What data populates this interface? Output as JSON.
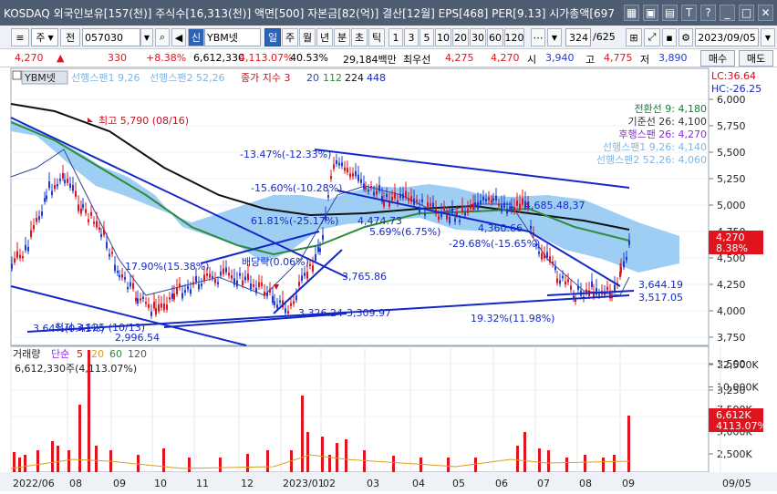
{
  "window": {
    "title": "KOSDAQ 외국인보유[157(천)] 주식수[16,313(천)] 액면[500] 자본금[82(억)] 결산[12월] EPS[468] PER[9.13] 시가총액[697"
  },
  "toolbar": {
    "type_select": "주",
    "prev_btn": "전",
    "code": "057030",
    "credit_badge": "신",
    "stock_name": "YBM넷",
    "period_buttons": [
      "일",
      "주",
      "월",
      "년",
      "분",
      "초",
      "틱"
    ],
    "active_period": "일",
    "interval_buttons": [
      "1",
      "3",
      "5",
      "10",
      "20",
      "30",
      "60",
      "120"
    ],
    "count": "324",
    "total": "/625",
    "date": "2023/09/05"
  },
  "price": {
    "current": "4,270",
    "arrow": "▲",
    "change": "330",
    "pct": "+8.38%",
    "volume": "6,612,330",
    "vol_pct": "4,113.07%",
    "turnover": "40.53%",
    "amount": "29,184백만",
    "pref_label": "최우선",
    "ask": "4,275",
    "bid": "4,270",
    "open_label": "시",
    "open": "3,940",
    "high_label": "고",
    "high": "4,775",
    "low_label": "저",
    "low": "3,890",
    "buy_btn": "매수",
    "sell_btn": "매도"
  },
  "chart_labels": {
    "stock_tag": "YBM넷",
    "span1_legend": "선행스팬1 9,26",
    "span2_legend": "선행스팬2 52,26",
    "ma_legend": "종가 지수 3",
    "ma_periods": [
      "20",
      "112",
      "224",
      "448"
    ],
    "lc": "LC:36.64",
    "hc": "HC:-26.25",
    "ichimoku": [
      {
        "text": "전환선 9: 4,180",
        "color": "#1a7a3a"
      },
      {
        "text": "기준선 26: 4,100",
        "color": "#333333"
      },
      {
        "text": "후행스팬 26: 4,270",
        "color": "#8a2be2"
      },
      {
        "text": "선행스팬1 9,26: 4,140",
        "color": "#7fb6e6"
      },
      {
        "text": "선행스팬2 52,26: 4,060",
        "color": "#7fb6e6"
      }
    ],
    "current_tag": "4,270",
    "current_pct_tag": "8.38%",
    "max_label": "최고 5,790 (08/16)",
    "min_label": "최저 3,125 (10/13)",
    "annotations": [
      "-13.47%(-12.33%)",
      "-15.60%(-10.28%)",
      "61.81%(-25.17%)",
      "4,474.73",
      "5.69%(6.75%)",
      "4,360.66",
      "4,685.48,37",
      "-29.68%(-15.65%)",
      "17.90%(15.38%)",
      "3,765.86",
      "배당락(0.06%)",
      "3,326.24",
      "3,309.97",
      "3.64%(0.41%)",
      "2,996.54",
      "3,644.19",
      "3,517.05",
      "19.32%(11.98%)"
    ],
    "vol_legend_label": "거래량",
    "vol_ma_label": "단순",
    "vol_ma_periods": [
      "5",
      "20",
      "60",
      "120"
    ],
    "vol_info": "6,612,330주(4,113.07%)",
    "vol_current_tag": "6,612K",
    "vol_pct_tag": "4113.07%",
    "x_axis": [
      "2022/06",
      "08",
      "09",
      "10",
      "11",
      "12",
      "2023/01",
      "02",
      "03",
      "04",
      "05",
      "06",
      "07",
      "08",
      "09",
      "09/05"
    ],
    "price_axis": [
      "6,000",
      "5,750",
      "5,500",
      "5,250",
      "5,000",
      "4,750",
      "4,500",
      "4,250",
      "4,000",
      "3,750",
      "3,500",
      "3,250",
      "3,000"
    ],
    "vol_axis": [
      "12,500K",
      "10,000K",
      "7,500K",
      "5,000K",
      "2,500K"
    ]
  }
}
